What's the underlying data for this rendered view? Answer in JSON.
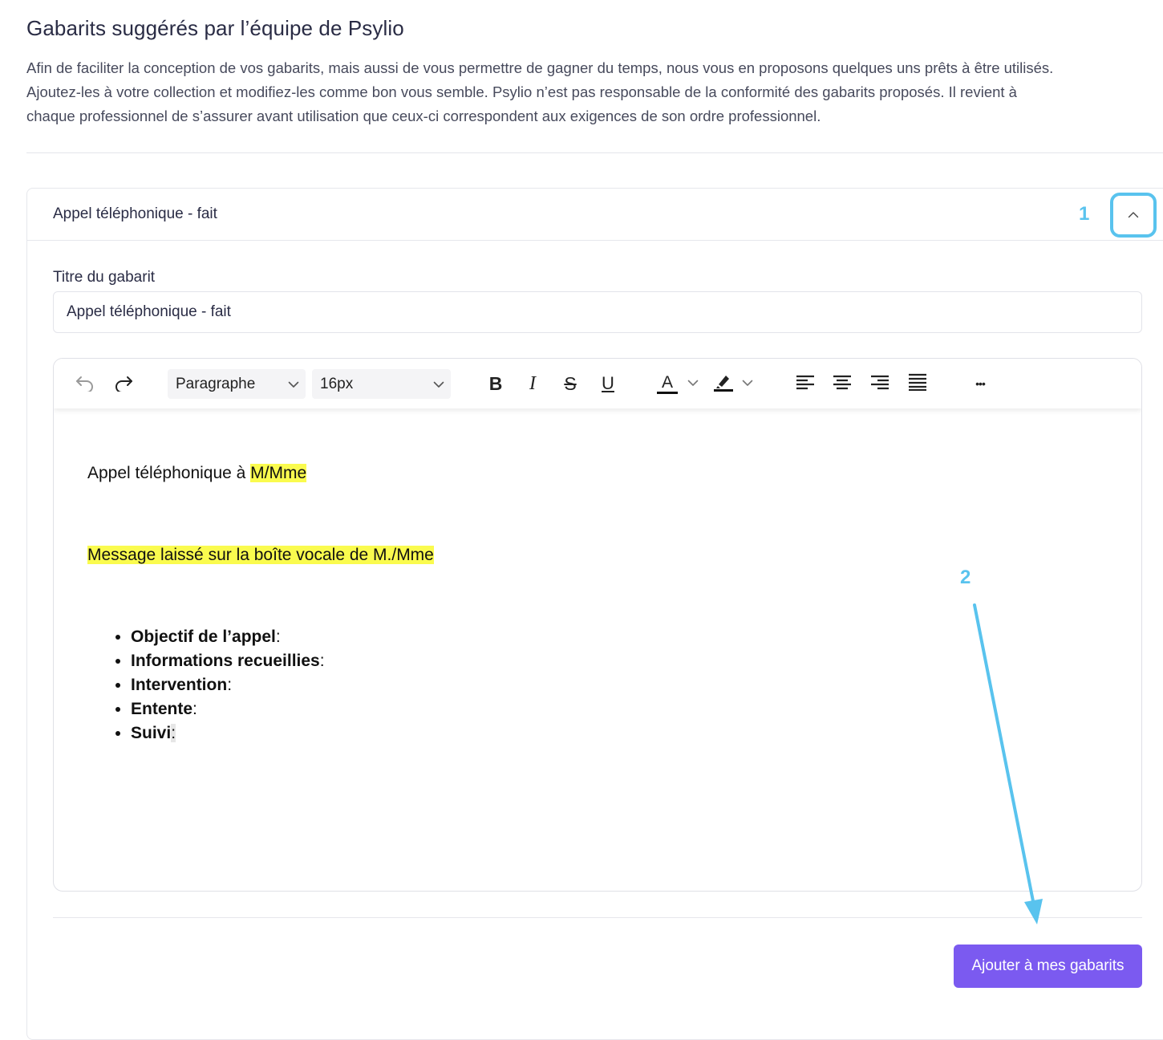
{
  "page": {
    "title": "Gabarits suggérés par l’équipe de Psylio",
    "intro_lines": [
      "Afin de faciliter la conception de vos gabarits, mais aussi de vous permettre de gagner du temps, nous vous en proposons quelques uns prêts à être utilisés.",
      "Ajoutez-les à votre collection et modifiez-les comme bon vous semble. Psylio n’est pas responsable de la conformité des gabarits proposés. Il revient à",
      "chaque professionnel de s’assurer avant utilisation que ceux-ci correspondent aux exigences de son ordre professionnel."
    ]
  },
  "template_card": {
    "header_title": "Appel téléphonique - fait",
    "collapse_icon": "chevron-up-icon",
    "field_label": "Titre du gabarit",
    "title_value": "Appel téléphonique - fait"
  },
  "toolbar": {
    "paragraph_style": "Paragraphe",
    "font_size": "16px",
    "bold": "B",
    "italic": "I",
    "strike": "S",
    "underline": "U",
    "text_color_letter": "A",
    "more": "•••"
  },
  "editor_content": {
    "line1_prefix": "Appel téléphonique à ",
    "line1_highlight": "M/Mme",
    "line2_highlight": "Message laissé sur la boîte vocale de M./Mme",
    "bullets": [
      {
        "bold": "Objectif de l’appel",
        "rest": ":"
      },
      {
        "bold": "Informations recueillies",
        "rest": ":"
      },
      {
        "bold": "Intervention",
        "rest": ":"
      },
      {
        "bold": "Entente",
        "rest": ":"
      },
      {
        "bold": "Suivi",
        "rest": ":"
      }
    ]
  },
  "actions": {
    "add_label": "Ajouter à mes gabarits"
  },
  "annotations": {
    "marker_1": "1",
    "marker_2": "2"
  },
  "colors": {
    "accent_purple": "#7b5af0",
    "annotation_blue": "#59c3ee",
    "highlight_yellow": "#fafb4e"
  }
}
